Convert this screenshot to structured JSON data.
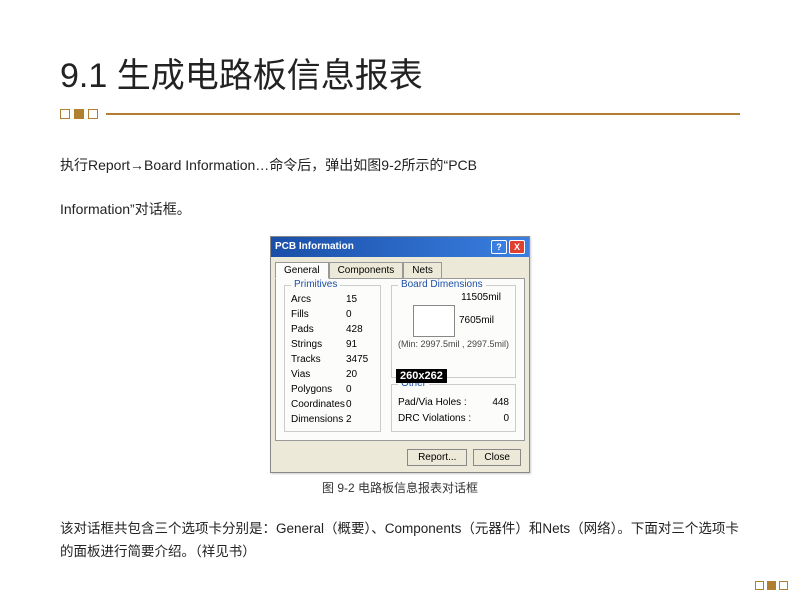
{
  "title": "9.1 生成电路板信息报表",
  "para1_a": "执行",
  "para1_b": "Report→Board Information…",
  "para1_c": "命令后，弹出如图9-2所示的“",
  "para1_d": "PCB",
  "para2_a": "Information",
  "para2_b": "”对话框。",
  "dialog": {
    "title": "PCB Information",
    "tabs": [
      "General",
      "Components",
      "Nets"
    ],
    "primitives_label": "Primitives",
    "primitives": [
      {
        "label": "Arcs",
        "val": "15"
      },
      {
        "label": "Fills",
        "val": "0"
      },
      {
        "label": "Pads",
        "val": "428"
      },
      {
        "label": "Strings",
        "val": "91"
      },
      {
        "label": "Tracks",
        "val": "3475"
      },
      {
        "label": "Vias",
        "val": "20"
      },
      {
        "label": "Polygons",
        "val": "0"
      },
      {
        "label": "Coordinates",
        "val": "0"
      },
      {
        "label": "Dimensions",
        "val": "2"
      }
    ],
    "dimensions_label": "Board Dimensions",
    "dim_w": "11505mil",
    "dim_h": "7605mil",
    "dim_min": "(Min: 2997.5mil , 2997.5mil)",
    "other_label": "Other",
    "other": [
      {
        "label": "Pad/Via Holes :",
        "val": "448"
      },
      {
        "label": "DRC Violations :",
        "val": "0"
      }
    ],
    "size_badge": "260x262",
    "btn_report": "Report...",
    "btn_close": "Close"
  },
  "caption": "图 9-2  电路板信息报表对话框",
  "footer_a": "该对话框共包含三个选项卡分别是：",
  "footer_b": "General",
  "footer_c": "（概要）、",
  "footer_d": "Components",
  "footer_e": "（元器件）和",
  "footer_f": "Nets",
  "footer_g": "（网络）。下面对三个选项卡的面板进行简要介绍。（祥见书）"
}
